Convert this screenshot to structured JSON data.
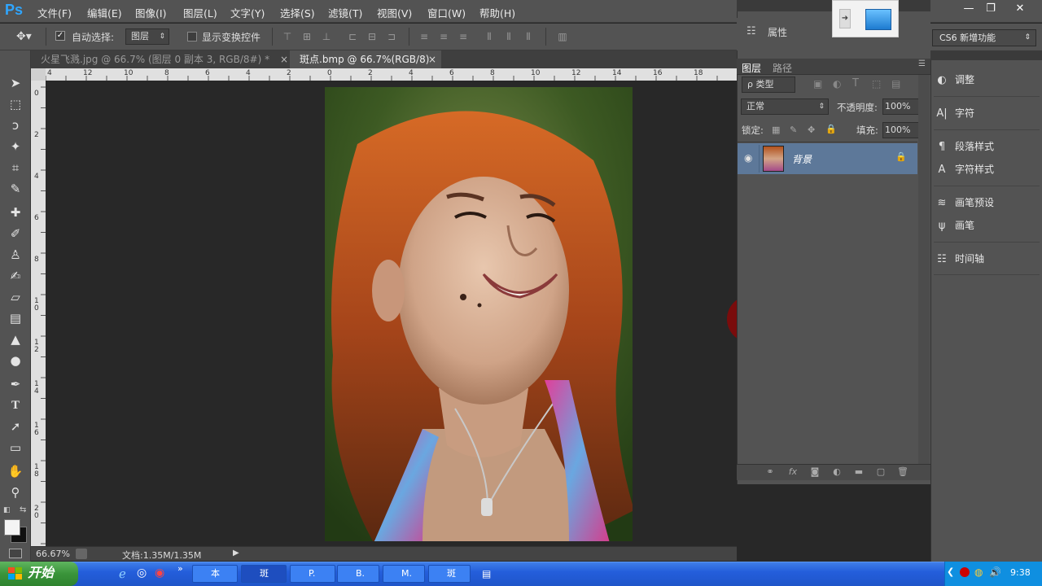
{
  "app": {
    "logo": "Ps",
    "menus": [
      "文件(F)",
      "编辑(E)",
      "图像(I)",
      "图层(L)",
      "文字(Y)",
      "选择(S)",
      "滤镜(T)",
      "视图(V)",
      "窗口(W)",
      "帮助(H)"
    ],
    "window_controls": [
      "—",
      "❐",
      "✕"
    ]
  },
  "options_bar": {
    "auto_select_label": "自动选择:",
    "auto_select_checked": true,
    "auto_select_value": "图层",
    "show_transform_label": "显示变换控件",
    "show_transform_checked": false
  },
  "tabs": [
    {
      "label": "火星飞溅.jpg @ 66.7% (图层 0 副本 3, RGB/8#) *",
      "active": false
    },
    {
      "label": "斑点.bmp @ 66.7%(RGB/8)",
      "active": true
    }
  ],
  "rulers": {
    "h_labels": [
      "4",
      "12",
      "10",
      "8",
      "6",
      "4",
      "2",
      "0",
      "2",
      "4",
      "6",
      "8",
      "10",
      "12",
      "14",
      "16",
      "18"
    ],
    "v_labels": [
      "0",
      "2",
      "4",
      "6",
      "8",
      "1 0",
      "1 2",
      "1 4",
      "1 6",
      "1 8",
      "2 0"
    ]
  },
  "status": {
    "zoom": "66.67%",
    "doc_info": "文档:1.35M/1.35M"
  },
  "workspace": {
    "label": "CS6 新增功能"
  },
  "properties_panel": {
    "label": "属性"
  },
  "layers_panel": {
    "tabs": [
      "图层",
      "路径"
    ],
    "filter_label": "ρ 类型",
    "blend_mode": "正常",
    "opacity_label": "不透明度:",
    "opacity_value": "100%",
    "lock_label": "锁定:",
    "fill_label": "填充:",
    "fill_value": "100%",
    "layers": [
      {
        "name": "背景",
        "visible": true,
        "locked": true,
        "selected": true
      }
    ]
  },
  "right_panels": [
    {
      "label": "调整",
      "icon": "adjustments-icon"
    },
    {
      "label": "字符",
      "icon": "character-icon"
    },
    {
      "label": "段落样式",
      "icon": "paragraph-styles-icon"
    },
    {
      "label": "字符样式",
      "icon": "character-styles-icon"
    },
    {
      "label": "画笔预设",
      "icon": "brush-presets-icon"
    },
    {
      "label": "画笔",
      "icon": "brush-icon"
    },
    {
      "label": "时间轴",
      "icon": "timeline-icon"
    }
  ],
  "taskbar": {
    "start_label": "开始",
    "tasks": [
      "本",
      "斑",
      "P.",
      "B.",
      "M.",
      "斑"
    ],
    "clock": "9:38"
  },
  "colors": {
    "ps_blue": "#2fa6ff",
    "panel_bg": "#535353",
    "selected_layer": "#5d7899",
    "cursor_ring": "#7a0c0c"
  }
}
